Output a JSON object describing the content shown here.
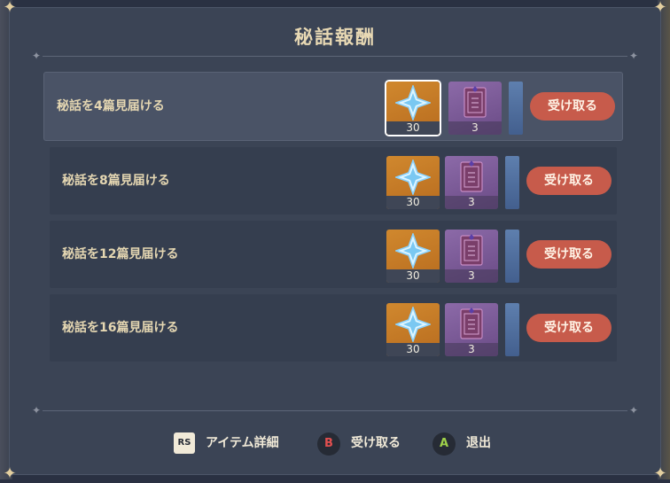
{
  "title": "秘話報酬",
  "rows": [
    {
      "label": "秘話を4篇見届ける",
      "items": [
        {
          "type": "gold",
          "icon": "primogem-icon",
          "qty": "30"
        },
        {
          "type": "purple",
          "icon": "book-icon",
          "qty": "3"
        }
      ],
      "claim": "受け取る"
    },
    {
      "label": "秘話を8篇見届ける",
      "items": [
        {
          "type": "gold",
          "icon": "primogem-icon",
          "qty": "30"
        },
        {
          "type": "purple",
          "icon": "book-icon",
          "qty": "3"
        }
      ],
      "claim": "受け取る"
    },
    {
      "label": "秘話を12篇見届ける",
      "items": [
        {
          "type": "gold",
          "icon": "primogem-icon",
          "qty": "30"
        },
        {
          "type": "purple",
          "icon": "book-icon",
          "qty": "3"
        }
      ],
      "claim": "受け取る"
    },
    {
      "label": "秘話を16篇見届ける",
      "items": [
        {
          "type": "gold",
          "icon": "primogem-icon",
          "qty": "30"
        },
        {
          "type": "purple",
          "icon": "book-icon",
          "qty": "3"
        }
      ],
      "claim": "受け取る"
    }
  ],
  "footer": {
    "item_detail": {
      "label": "アイテム詳細",
      "key": "RS"
    },
    "claim": {
      "label": "受け取る",
      "key": "B"
    },
    "exit": {
      "label": "退出",
      "key": "A"
    }
  },
  "colors": {
    "accent_button": "#c75b4b",
    "title": "#e8d9b4",
    "key_b": "#e24f4f",
    "key_a": "#9fd24a"
  }
}
